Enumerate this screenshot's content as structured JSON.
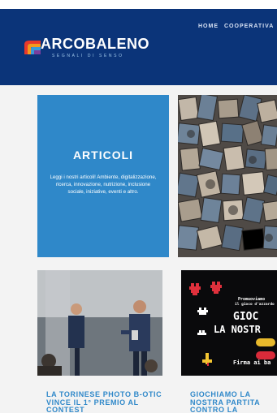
{
  "header": {
    "brand_name": "ARCOBALENO",
    "brand_tagline": "SEGNALI DI SENSO",
    "nav": [
      "HOME",
      "COOPERATIVA"
    ],
    "colors": {
      "header_bg": "#0b3479",
      "accent": "#2f88c9"
    }
  },
  "promo": {
    "title": "ARTICOLI",
    "text": "Leggi i nostri articoli! Ambiente, digitalizzazione, ricerca, innovazione, nutrizione, inclusione sociale, iniziative, eventi e altro."
  },
  "cards": [
    {
      "title": "LA TORINESE PHOTO B-OTIC VINCE IL 1° PREMIO AL CONTEST",
      "image": "award-photo"
    },
    {
      "title": "GIOCHIAMO LA NOSTRA PARTITA CONTRO LA",
      "image": "game-poster",
      "poster": {
        "top_line_1": "Promuoviamo",
        "top_line_2": "il gioco d'azzardo",
        "big_1": "GIOC",
        "big_2": "LA NOSTR",
        "bottom": "Firma ai ba"
      }
    }
  ]
}
